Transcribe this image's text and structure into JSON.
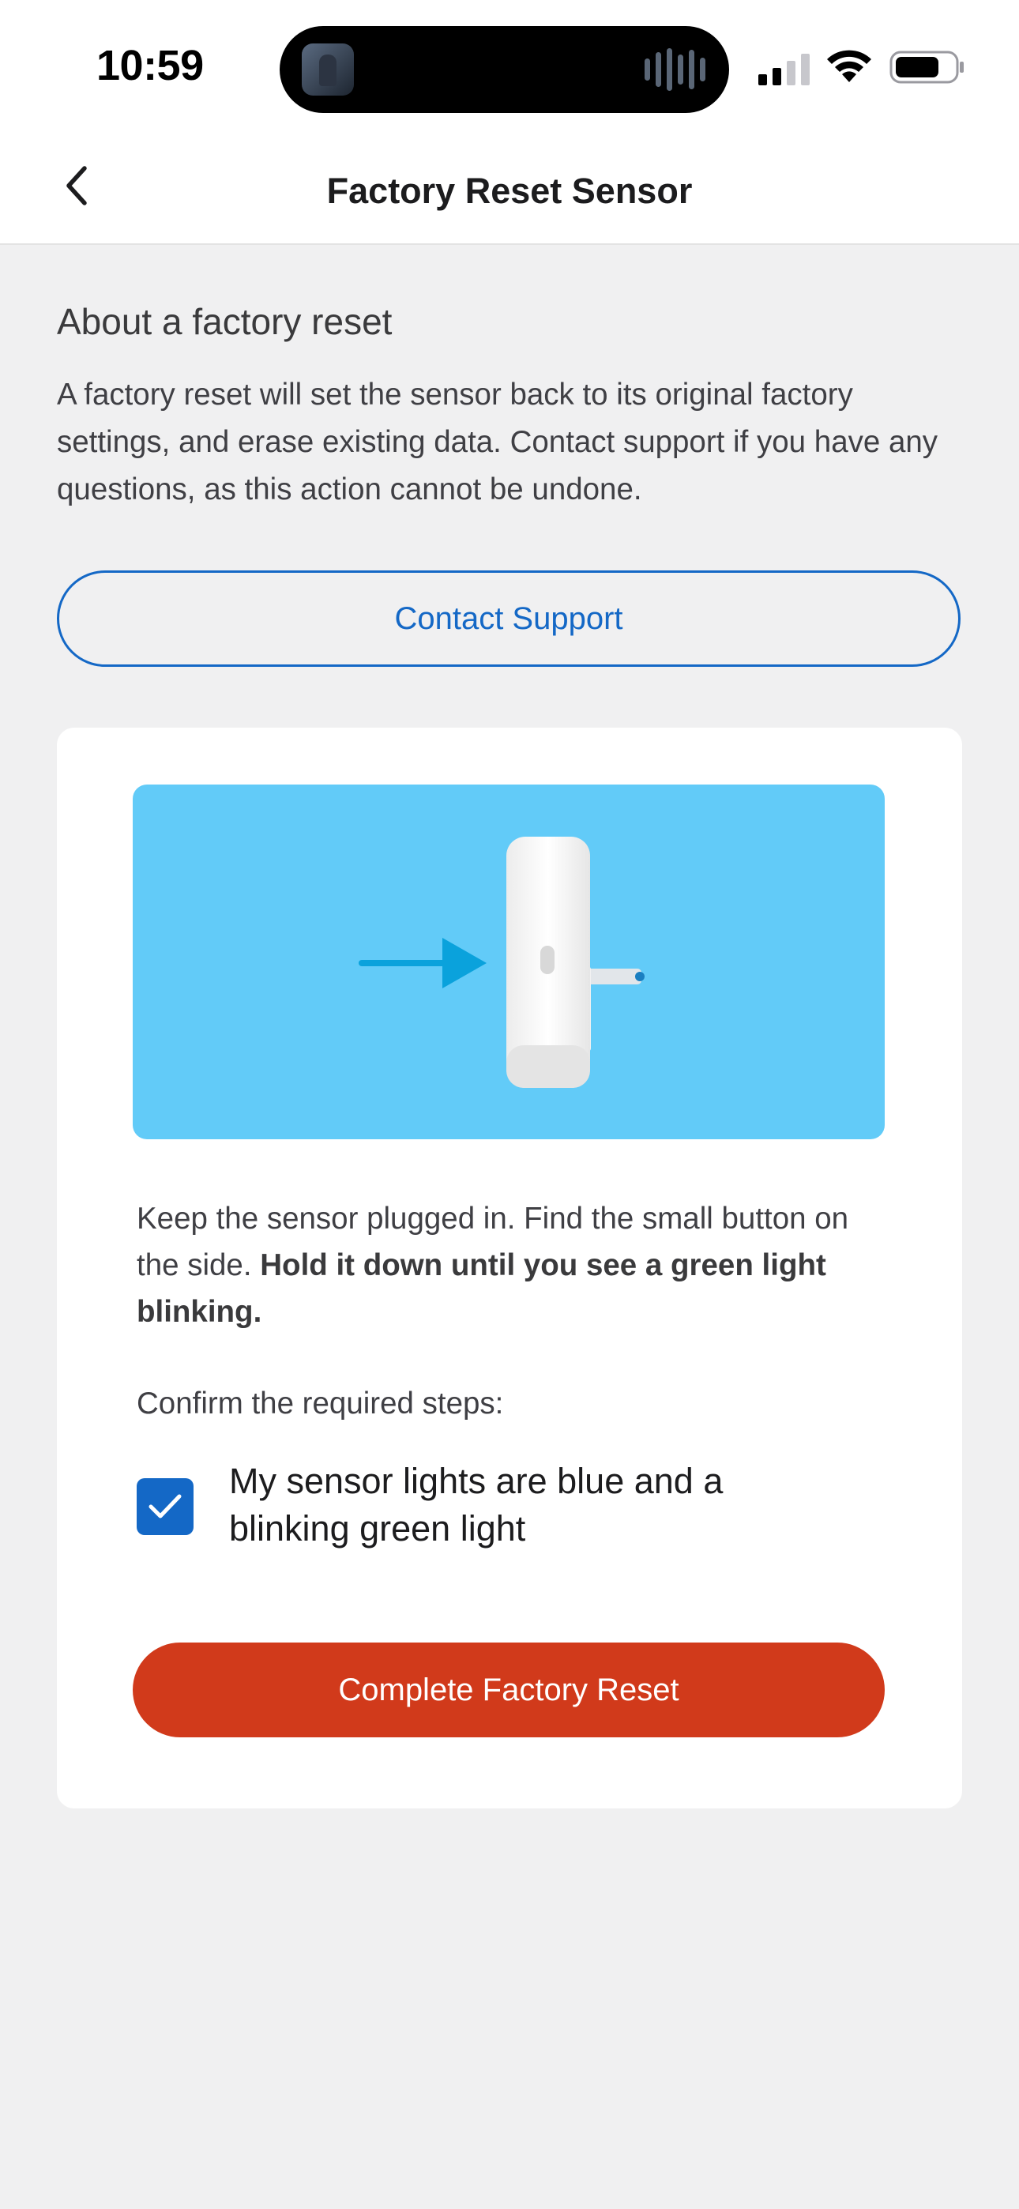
{
  "status_bar": {
    "time": "10:59",
    "signal_icon": "cellular-signal-icon",
    "wifi_icon": "wifi-icon",
    "battery_icon": "battery-icon"
  },
  "nav": {
    "title": "Factory Reset Sensor",
    "back_icon": "chevron-left-icon"
  },
  "about": {
    "heading": "About a factory reset",
    "body": "A factory reset will set the sensor back to its original factory settings, and erase existing data. Contact support if you have any questions, as this action cannot be undone."
  },
  "contact_button": {
    "label": "Contact Support"
  },
  "card": {
    "illustration_icon": "sensor-plug-illustration",
    "instruction_plain": "Keep the sensor plugged in. Find the small button on the side. ",
    "instruction_bold": "Hold it down until you see a green light blinking.",
    "confirm_label": "Confirm the required steps:",
    "checkbox": {
      "checked": true,
      "label": "My sensor lights are blue and a blinking green light"
    },
    "reset_button_label": "Complete Factory Reset"
  },
  "colors": {
    "accent_blue": "#1468c6",
    "danger_red": "#d13a1b",
    "illustration_bg": "#62cbf8",
    "page_bg": "#f0f0f1"
  }
}
